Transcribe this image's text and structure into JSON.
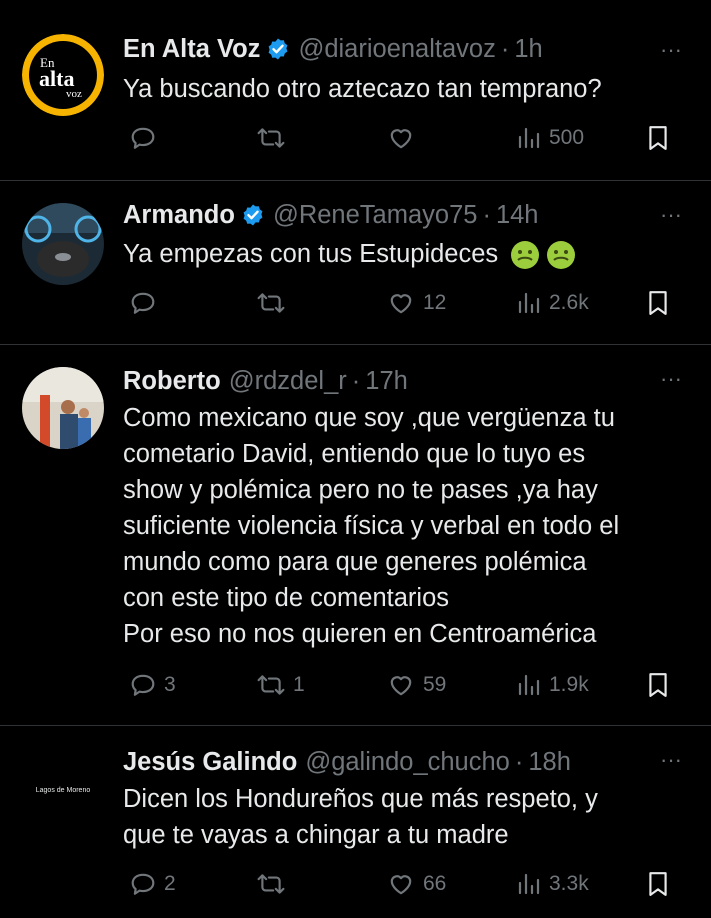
{
  "tweets": [
    {
      "name": "En Alta Voz",
      "verified": true,
      "handle": "@diarioenaltavoz",
      "separator": "·",
      "time": "1h",
      "lines": [
        "Ya buscando otro aztecazo tan temprano?"
      ],
      "reply_count": "",
      "retweet_count": "",
      "like_count": "",
      "view_count": "500",
      "avatar_text": {
        "line1": "En",
        "line2": "alta",
        "line3": "voz"
      }
    },
    {
      "name": "Armando",
      "verified": true,
      "handle": "@ReneTamayo75",
      "separator": "·",
      "time": "14h",
      "lines": [
        "Ya empezas con tus Estupideces"
      ],
      "emojis": [
        "nauseated-face-emoji",
        "nauseated-face-emoji"
      ],
      "reply_count": "",
      "retweet_count": "",
      "like_count": "12",
      "view_count": "2.6k"
    },
    {
      "name": "Roberto",
      "verified": false,
      "handle": "@rdzdel_r",
      "separator": "·",
      "time": "17h",
      "lines": [
        "Como mexicano que soy ,que vergüenza tu",
        "cometario David, entiendo que lo tuyo es",
        "show y polémica pero no te pases ,ya hay",
        "suficiente violencia física y verbal en todo el",
        "mundo como para que generes polémica",
        "con este tipo de comentarios",
        "Por eso no nos quieren en Centroamérica"
      ],
      "reply_count": "3",
      "retweet_count": "1",
      "like_count": "59",
      "view_count": "1.9k"
    },
    {
      "name": "Jesús Galindo",
      "verified": false,
      "handle": "@galindo_chucho",
      "separator": "·",
      "time": "18h",
      "lines": [
        "Dicen los Hondureños que más respeto, y",
        "que te vayas a chingar a tu madre"
      ],
      "reply_count": "2",
      "retweet_count": "",
      "like_count": "66",
      "view_count": "3.3k",
      "avatar_text": {
        "line1": "Lagos de Moreno"
      }
    }
  ],
  "icons": {
    "reply": "reply-icon",
    "retweet": "retweet-icon",
    "like": "like-icon",
    "views": "views-icon",
    "bookmark": "bookmark-icon",
    "more": "more-icon",
    "verified": "verified-badge-icon"
  },
  "more_label": "···",
  "colors": {
    "background": "#000000",
    "text": "#e7e9ea",
    "secondary": "#71767b",
    "divider": "#2f3336",
    "verified": "#1d9bf0",
    "brand_avatar_ring": "#f6b400"
  }
}
